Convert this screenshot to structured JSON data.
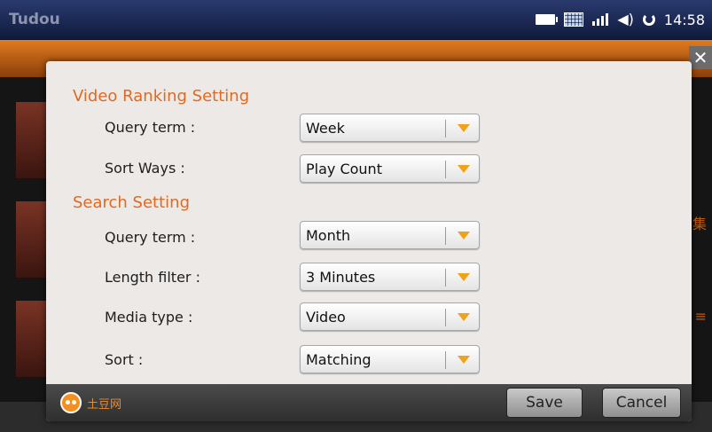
{
  "app": {
    "title": "Tudou",
    "clock": "14:58"
  },
  "status_icons": [
    "battery-icon",
    "keyboard-icon",
    "signal-icon",
    "volume-icon",
    "sync-icon"
  ],
  "dialog": {
    "video_ranking": {
      "title": "Video Ranking Setting",
      "rows": [
        {
          "label": "Query term :",
          "value": "Week"
        },
        {
          "label": "Sort Ways :",
          "value": "Play Count"
        }
      ]
    },
    "search": {
      "title": "Search Setting",
      "rows": [
        {
          "label": "Query term :",
          "value": "Month"
        },
        {
          "label": "Length filter :",
          "value": "3 Minutes"
        },
        {
          "label": "Media type :",
          "value": "Video"
        },
        {
          "label": "Sort :",
          "value": "Matching"
        }
      ]
    },
    "footer": {
      "logo_text": "土豆网",
      "save_label": "Save",
      "cancel_label": "Cancel"
    }
  },
  "background": {
    "side_text_1": "集",
    "side_text_2": "≡"
  },
  "colors": {
    "accent": "#e2691f",
    "chevron": "#f0a21a",
    "topbar": "#1a2752"
  }
}
